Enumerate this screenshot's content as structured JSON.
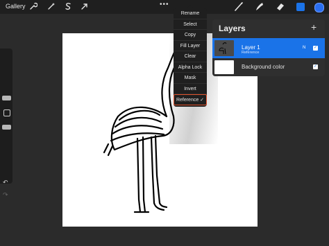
{
  "topbar": {
    "gallery_label": "Gallery",
    "more_label": "•••",
    "left_tools": [
      "wrench-icon",
      "magic-wand-icon",
      "selection-s-icon",
      "transform-arrow-icon"
    ],
    "right_tools": [
      "brush-icon",
      "smudge-icon",
      "eraser-icon"
    ],
    "accent_color": "#1b73e8"
  },
  "menu": {
    "items": [
      "Rename",
      "Select",
      "Copy",
      "Fill Layer",
      "Clear",
      "Alpha Lock",
      "Mask",
      "Invert",
      "Reference ✓"
    ],
    "highlight_color": "#e0522c"
  },
  "layers": {
    "title": "Layers",
    "add_label": "+",
    "layer1": {
      "name": "Layer 1",
      "subtitle": "Reference",
      "blend": "N",
      "checked": "✓"
    },
    "background": {
      "name": "Background color",
      "checked": "✓"
    }
  },
  "sidebar": {
    "undo_label": "↶",
    "redo_label": "↷"
  }
}
